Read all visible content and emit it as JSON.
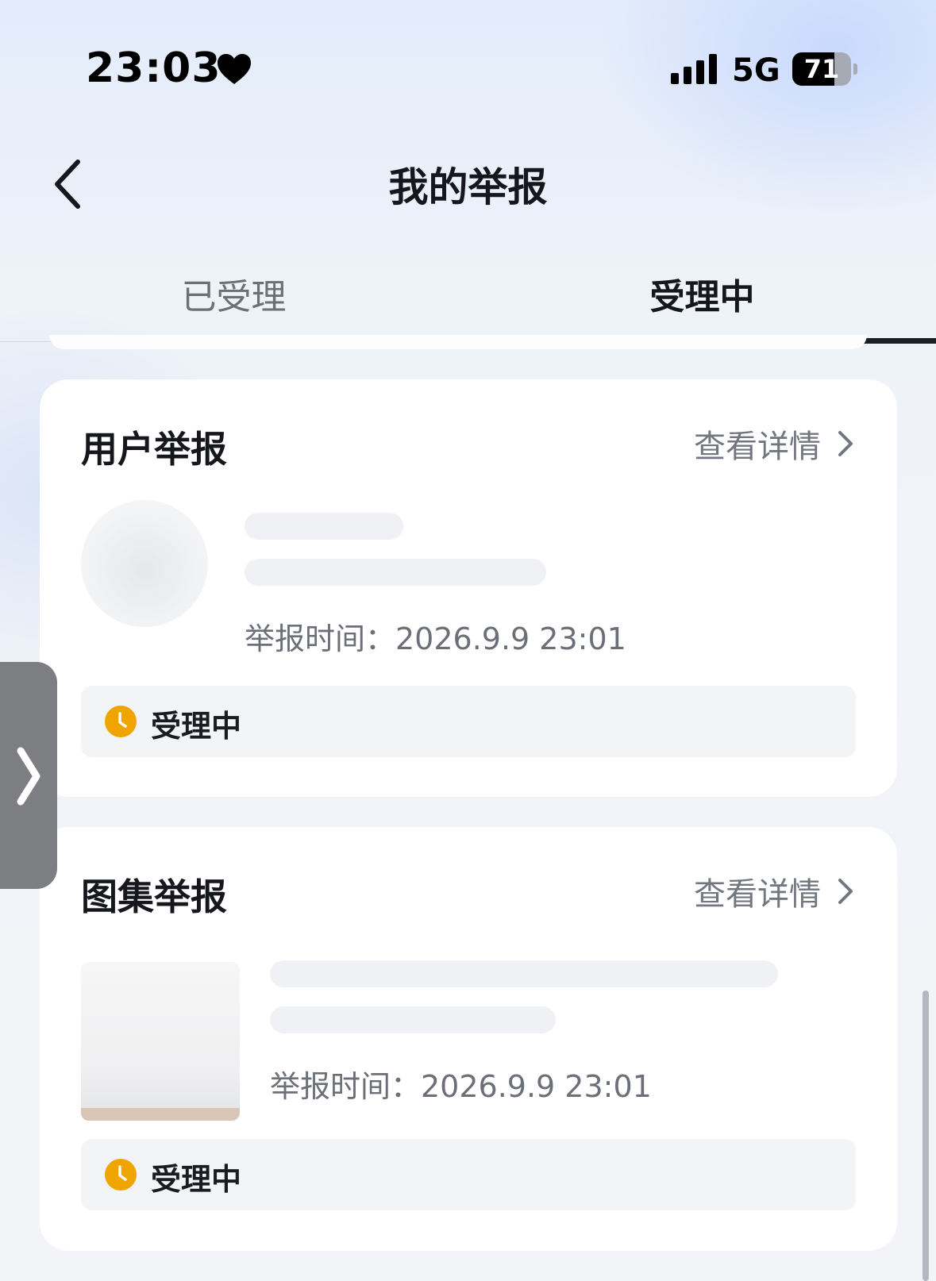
{
  "status_bar": {
    "time": "23:03",
    "network": "5G",
    "battery_level": "71",
    "battery_fraction": 0.71
  },
  "header": {
    "title": "我的举报",
    "back_icon": "chevron-left-icon"
  },
  "tabs": [
    {
      "label": "已受理",
      "active": false
    },
    {
      "label": "受理中",
      "active": true
    }
  ],
  "reports": [
    {
      "title": "用户举报",
      "detail_label": "查看详情",
      "report_time": "举报时间：2026.9.9 23:01",
      "status": "受理中",
      "status_icon": "clock-icon"
    },
    {
      "title": "图集举报",
      "detail_label": "查看详情",
      "report_time": "举报时间：2026.9.9 23:01",
      "status": "受理中",
      "status_icon": "clock-icon"
    }
  ],
  "colors": {
    "status_accent": "#f0a400",
    "tab_underline": "#1a1d26",
    "card_background": "#ffffff"
  }
}
